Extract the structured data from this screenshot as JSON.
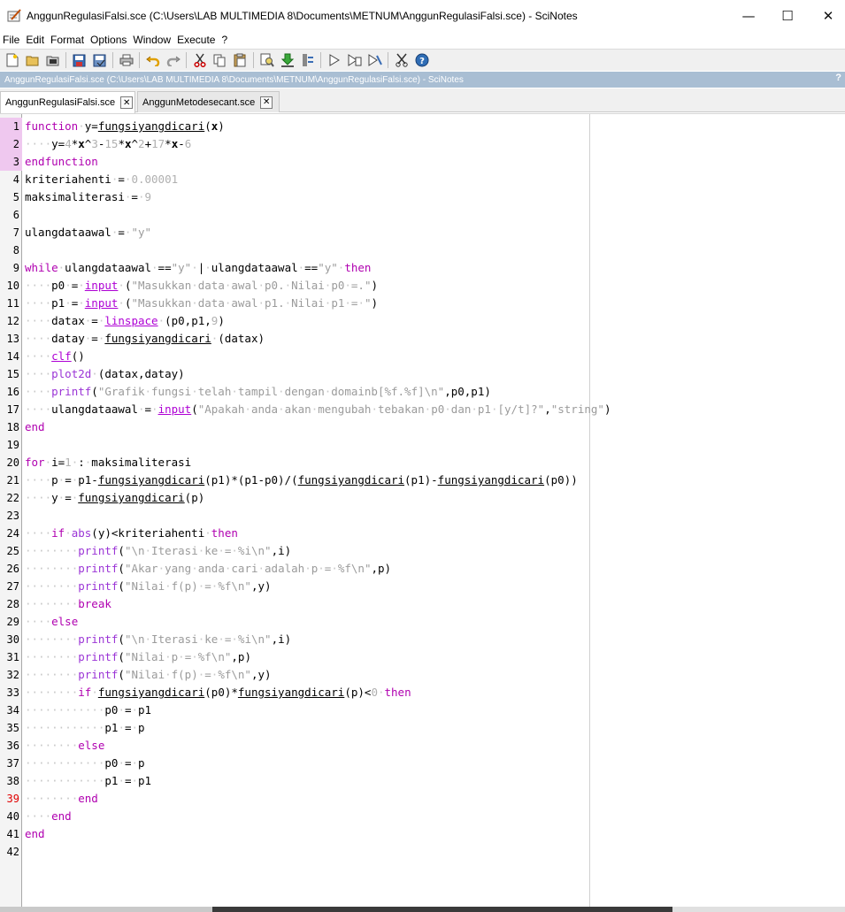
{
  "window": {
    "title": "AnggunRegulasiFalsi.sce (C:\\Users\\LAB MULTIMEDIA 8\\Documents\\METNUM\\AnggunRegulasiFalsi.sce) - SciNotes",
    "minimize": "—",
    "maximize": "☐",
    "close": "✕"
  },
  "menu": [
    "File",
    "Edit",
    "Format",
    "Options",
    "Window",
    "Execute",
    "?"
  ],
  "toolbar_icons": [
    "new-file-icon",
    "open-folder-icon",
    "open-file-icon",
    "save-icon",
    "save-as-icon",
    "print-icon",
    "undo-icon",
    "redo-icon",
    "cut-icon",
    "copy-icon",
    "paste-icon",
    "find-icon",
    "download-icon",
    "format-icon",
    "execute-icon",
    "execute-file-icon",
    "execute-until-cursor-icon",
    "cut-tool-icon",
    "help-icon"
  ],
  "path_bar": {
    "text": "AnggunRegulasiFalsi.sce (C:\\Users\\LAB MULTIMEDIA 8\\Documents\\METNUM\\AnggunRegulasiFalsi.sce) - SciNotes",
    "help": "?"
  },
  "tabs": [
    {
      "label": "AnggunRegulasiFalsi.sce",
      "active": true
    },
    {
      "label": "AnggunMetodesecant.sce",
      "active": false
    }
  ],
  "line_numbers": [
    "1",
    "2",
    "3",
    "4",
    "5",
    "6",
    "7",
    "8",
    "9",
    "10",
    "11",
    "12",
    "13",
    "14",
    "15",
    "16",
    "17",
    "18",
    "19",
    "20",
    "21",
    "22",
    "23",
    "24",
    "25",
    "26",
    "27",
    "28",
    "29",
    "30",
    "31",
    "32",
    "33",
    "34",
    "35",
    "36",
    "37",
    "38",
    "39",
    "40",
    "41",
    "42"
  ],
  "code_lines": [
    "function y=fungsiyangdicari(x)",
    "    y=4*x^3-15*x^2+17*x-6",
    "endfunction",
    "kriteriahenti = 0.00001",
    "maksimaliterasi = 9",
    "",
    "ulangdataawal = \"y\"",
    "",
    "while ulangdataawal ==\"y\" | ulangdataawal ==\"y\" then",
    "    p0 = input (\"Masukkan data awal p0. Nilai p0 =.\")",
    "    p1 = input (\"Masukkan data awal p1. Nilai p1 = \")",
    "    datax = linspace (p0,p1,9)",
    "    datay = fungsiyangdicari (datax)",
    "    clf()",
    "    plot2d (datax,datay)",
    "    printf(\"Grafik fungsi telah tampil dengan domainb[%f.%f]\\n\",p0,p1)",
    "    ulangdataawal = input(\"Apakah anda akan mengubah tebakan p0 dan p1 [y/t]?\",\"string\")",
    "end",
    "",
    "for i=1 : maksimaliterasi",
    "    p = p1-fungsiyangdicari(p1)*(p1-p0)/(fungsiyangdicari(p1)-fungsiyangdicari(p0))",
    "    y = fungsiyangdicari(p)",
    "",
    "    if abs(y)<kriteriahenti then",
    "        printf(\"\\n Iterasi ke = %i\\n\",i)",
    "        printf(\"Akar yang anda cari adalah p = %f\\n\",p)",
    "        printf(\"Nilai f(p) = %f\\n\",y)",
    "        break",
    "    else",
    "        printf(\"\\n Iterasi ke = %i\\n\",i)",
    "        printf(\"Nilai p = %f\\n\",p)",
    "        printf(\"Nilai f(p) = %f\\n\",y)",
    "        if fungsiyangdicari(p0)*fungsiyangdicari(p)<0 then",
    "            p0 = p1",
    "            p1 = p",
    "        else",
    "            p0 = p",
    "            p1 = p1",
    "        end",
    "    end",
    "end",
    ""
  ],
  "colors": {
    "keyword": "#b000b0",
    "string": "#9b9b9b",
    "number": "#b0b0b0",
    "path_bar": "#a9bed3",
    "fold_marker": "#efc8ef",
    "current_line_number": "#e00000"
  }
}
